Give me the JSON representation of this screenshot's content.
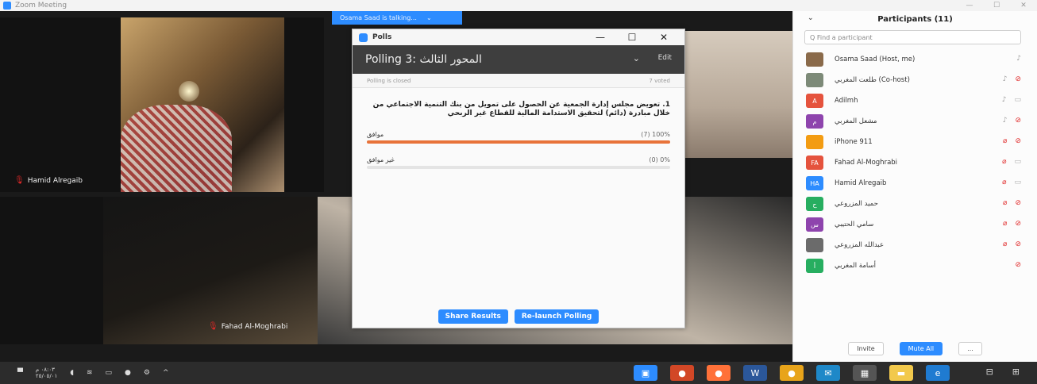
{
  "app": {
    "title": "Zoom Meeting"
  },
  "window_controls": {
    "minimize": "—",
    "maximize": "☐",
    "close": "✕"
  },
  "talking_banner": {
    "text": "Osama Saad is talking...",
    "caret": "⌄"
  },
  "video_tiles": {
    "tile1_name": "Hamid Alregaib",
    "tile2_name": "Fahad Al-Moghrabi"
  },
  "poll": {
    "window_title": "Polls",
    "controls": {
      "minimize": "—",
      "maximize": "☐",
      "close": "✕"
    },
    "header_title": "Polling 3: المحور الثالث",
    "header_chevron": "⌄",
    "edit_label": "Edit",
    "status": "Polling is closed",
    "voted": "7 voted",
    "question": "1. تعويض مجلس إدارة الجمعية عن الحصول على تمويل من بنك التنمية الاجتماعي من خلال مبادرة (دائم) لتحقيق الاستدامة المالية للقطاع غير الربحي",
    "answers": [
      {
        "text": "موافق",
        "stat": "(7) 100%",
        "fill": 100
      },
      {
        "text": "غير موافق",
        "stat": "(0) 0%",
        "fill": 0
      }
    ],
    "share_button": "Share Results",
    "relaunch_button": "Re-launch Polling"
  },
  "participants": {
    "header": "Participants (11)",
    "collapse_icon": "⌄",
    "search_placeholder": "Q Find a participant",
    "list": [
      {
        "name": "Osama Saad (Host, me)",
        "avatar_text": "",
        "avatar_color": "#8a6a4a",
        "mic": "on",
        "cam": "none"
      },
      {
        "name": "طلعت المغربي (Co-host)",
        "avatar_text": "",
        "avatar_color": "#7d8a78",
        "mic": "on",
        "cam": "off"
      },
      {
        "name": "Adilmh",
        "avatar_text": "A",
        "avatar_color": "#e5533d",
        "mic": "on",
        "cam": "on"
      },
      {
        "name": "مشعل المغربي",
        "avatar_text": "م",
        "avatar_color": "#8e44ad",
        "mic": "on",
        "cam": "off"
      },
      {
        "name": "iPhone 911",
        "avatar_text": "",
        "avatar_color": "#f39c12",
        "mic": "off",
        "cam": "off"
      },
      {
        "name": "Fahad Al-Moghrabi",
        "avatar_text": "FA",
        "avatar_color": "#e5533d",
        "mic": "off",
        "cam": "on"
      },
      {
        "name": "Hamid Alregaib",
        "avatar_text": "HA",
        "avatar_color": "#2d8cff",
        "mic": "off",
        "cam": "on"
      },
      {
        "name": "حميد المزروعي",
        "avatar_text": "ح",
        "avatar_color": "#27ae60",
        "mic": "off",
        "cam": "off"
      },
      {
        "name": "سامي الحتيبي",
        "avatar_text": "س",
        "avatar_color": "#8e44ad",
        "mic": "off",
        "cam": "off"
      },
      {
        "name": "عبدالله المزروعي",
        "avatar_text": "",
        "avatar_color": "#6b6b6b",
        "mic": "off",
        "cam": "off"
      },
      {
        "name": "أسامة المغربي",
        "avatar_text": "أ",
        "avatar_color": "#27ae60",
        "mic": "none",
        "cam": "off"
      }
    ],
    "invite_button": "Invite",
    "mute_all_button": "Mute All",
    "more_button": "..."
  },
  "taskbar": {
    "clock_time": "٠٨:٠٣ م",
    "clock_date": "٢٥/٠٥/٠١",
    "tray_icons": [
      "speaker-icon",
      "network-icon",
      "battery-icon",
      "mic-icon",
      "chevron-up-icon"
    ],
    "apps": [
      {
        "name": "zoom",
        "color": "#2d8cff",
        "glyph": "▣"
      },
      {
        "name": "powerpoint",
        "color": "#d24726",
        "glyph": "●"
      },
      {
        "name": "firefox",
        "color": "#ff7139",
        "glyph": "●"
      },
      {
        "name": "word",
        "color": "#2b579a",
        "glyph": "W"
      },
      {
        "name": "chrome",
        "color": "#e8a41a",
        "glyph": "●"
      },
      {
        "name": "mail",
        "color": "#1e88c8",
        "glyph": "✉"
      },
      {
        "name": "calculator",
        "color": "#555",
        "glyph": "▦"
      },
      {
        "name": "files",
        "color": "#f2c94c",
        "glyph": "▬"
      },
      {
        "name": "edge",
        "color": "#1f7bd1",
        "glyph": "e"
      }
    ]
  }
}
